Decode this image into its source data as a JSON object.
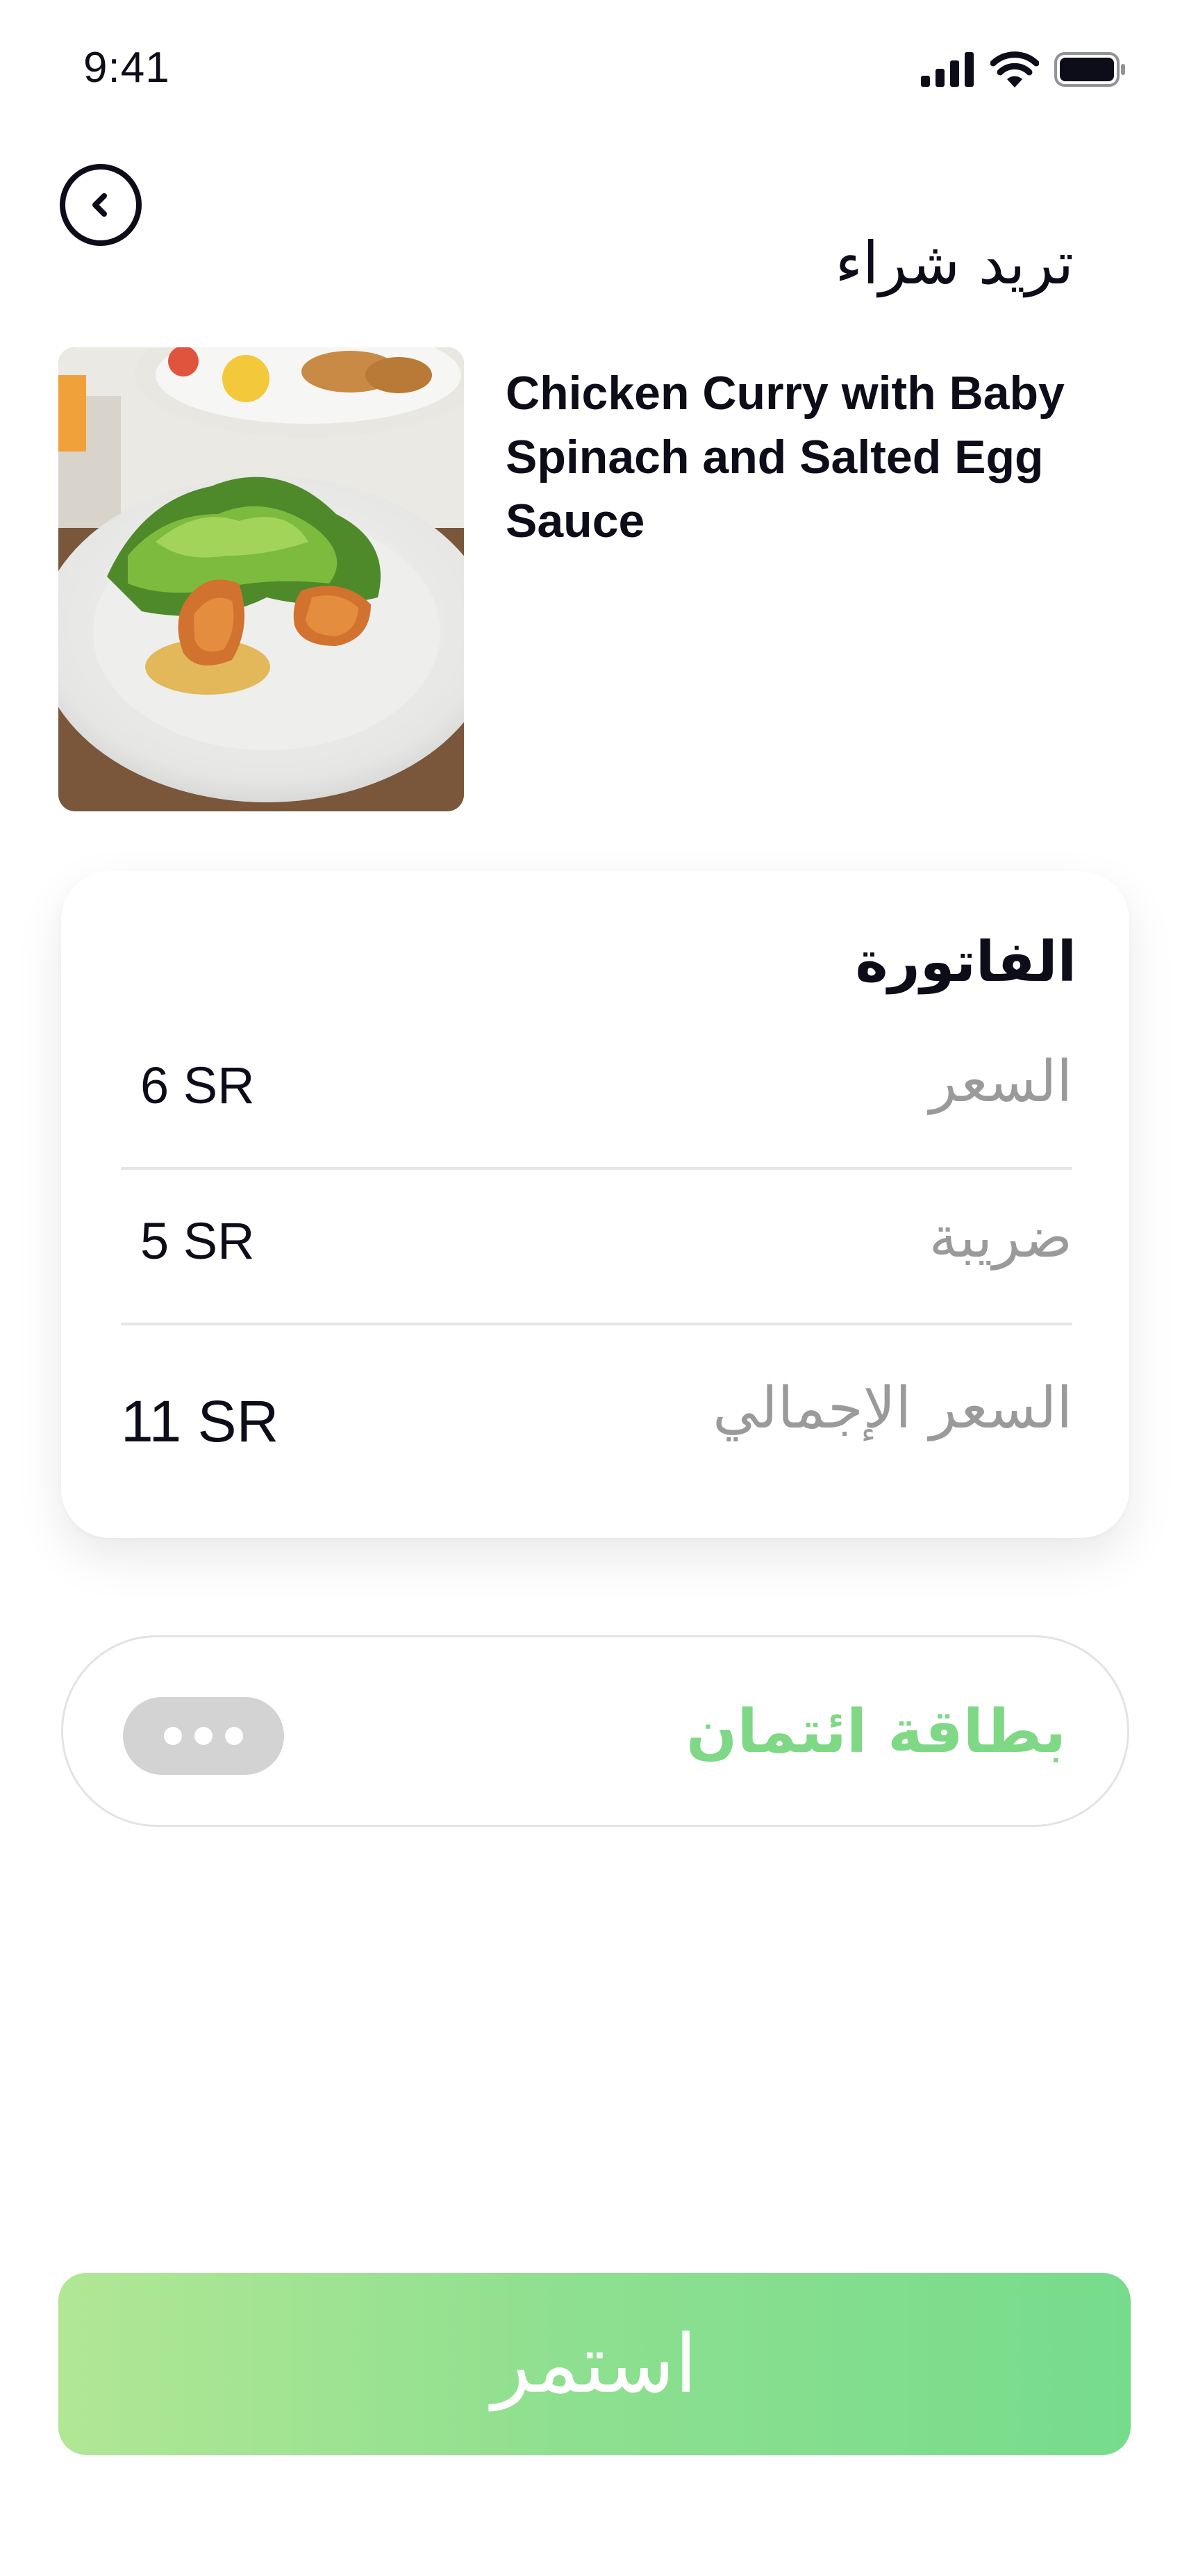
{
  "status_bar": {
    "time": "9:41",
    "icons": [
      "signal-icon",
      "wifi-icon",
      "battery-icon"
    ]
  },
  "header": {
    "back_icon": "chevron-left-icon",
    "title": "تريد شراء"
  },
  "product": {
    "image": "food-photo",
    "name": "Chicken Curry with Baby Spinach and Salted Egg Sauce"
  },
  "invoice": {
    "title": "الفاتورة",
    "rows": [
      {
        "label": "السعر",
        "value": "6 SR"
      },
      {
        "label": "ضريبة",
        "value": "5 SR"
      },
      {
        "label": "السعر الإجمالي",
        "value": "11 SR"
      }
    ]
  },
  "payment": {
    "label": "بطاقة ائتمان",
    "card_icon": "more-dots-icon"
  },
  "actions": {
    "continue_label": "استمر"
  },
  "colors": {
    "accent_green": "#7FD885",
    "button_gradient_start": "#B1E794",
    "button_gradient_end": "#76DC8C",
    "text_primary": "#0D0D1A",
    "text_muted": "#9A9A9A"
  }
}
